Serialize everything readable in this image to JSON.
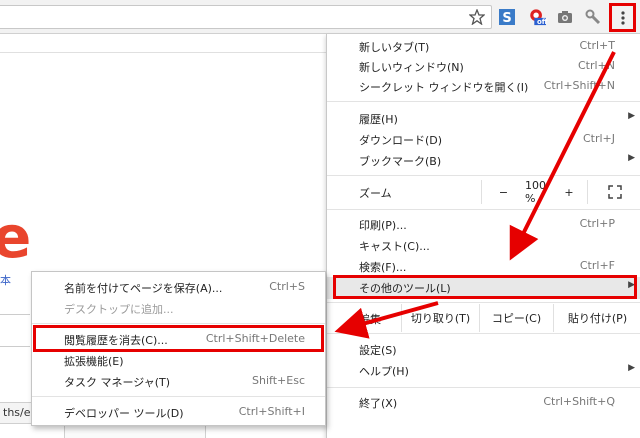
{
  "toolbar": {
    "icons": [
      "star-icon",
      "s-extension-icon",
      "off-extension-icon",
      "camera-icon",
      "wrench-icon"
    ],
    "off_badge": "off"
  },
  "page": {
    "letter": "e",
    "link_char": "本",
    "status_text": "ths/en"
  },
  "main_menu": {
    "items": [
      {
        "label": "新しいタブ(T)",
        "shortcut": "Ctrl+T"
      },
      {
        "label": "新しいウィンドウ(N)",
        "shortcut": "Ctrl+N"
      },
      {
        "label": "シークレット ウィンドウを開く(I)",
        "shortcut": "Ctrl+Shift+N"
      },
      {
        "label": "履歴(H)",
        "shortcut": ""
      },
      {
        "label": "ダウンロード(D)",
        "shortcut": "Ctrl+J"
      },
      {
        "label": "ブックマーク(B)",
        "shortcut": ""
      },
      {
        "label": "印刷(P)...",
        "shortcut": "Ctrl+P"
      },
      {
        "label": "キャスト(C)...",
        "shortcut": ""
      },
      {
        "label": "検索(F)...",
        "shortcut": "Ctrl+F"
      },
      {
        "label": "その他のツール(L)",
        "shortcut": ""
      },
      {
        "label": "設定(S)",
        "shortcut": ""
      },
      {
        "label": "ヘルプ(H)",
        "shortcut": ""
      },
      {
        "label": "終了(X)",
        "shortcut": "Ctrl+Shift+Q"
      }
    ],
    "zoom": {
      "label": "ズーム",
      "minus": "−",
      "value": "100 %",
      "plus": "+"
    },
    "edit": {
      "label": "編集",
      "cut": "切り取り(T)",
      "copy": "コピー(C)",
      "paste": "貼り付け(P)"
    }
  },
  "sub_menu": {
    "items": [
      {
        "label": "名前を付けてページを保存(A)...",
        "shortcut": "Ctrl+S"
      },
      {
        "label": "デスクトップに追加...",
        "shortcut": ""
      },
      {
        "label": "閲覧履歴を消去(C)...",
        "shortcut": "Ctrl+Shift+Delete"
      },
      {
        "label": "拡張機能(E)",
        "shortcut": ""
      },
      {
        "label": "タスク マネージャ(T)",
        "shortcut": "Shift+Esc"
      },
      {
        "label": "デベロッパー ツール(D)",
        "shortcut": "Ctrl+Shift+I"
      }
    ]
  },
  "colors": {
    "annotation": "#e60000",
    "accent_red": "#e9452d",
    "highlight": "#e8e8e8"
  }
}
